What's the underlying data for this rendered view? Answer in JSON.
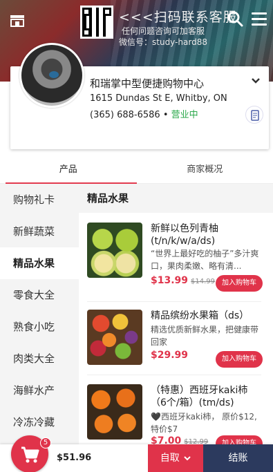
{
  "banner": {
    "line1": "<<<扫码联系客服",
    "line2": "任何问题咨询可加客服",
    "line3": "微信号：study-hard88"
  },
  "store": {
    "name": "和瑞掌中型便捷购物中心",
    "address": "1615 Dundas St E, Whitby, ON",
    "phone": "(365) 688-6586",
    "separator": "•",
    "status": "营业中"
  },
  "tabs": [
    {
      "label": "产品"
    },
    {
      "label": "商家概况"
    }
  ],
  "sidebar": {
    "items": [
      {
        "label": "购物礼卡"
      },
      {
        "label": "新鲜蔬菜"
      },
      {
        "label": "精品水果"
      },
      {
        "label": "零食大全"
      },
      {
        "label": "熟食小吃"
      },
      {
        "label": "肉类大全"
      },
      {
        "label": "海鲜水产"
      },
      {
        "label": "冷冻冷藏"
      }
    ],
    "active_index": 2
  },
  "section": {
    "title": "精品水果"
  },
  "products": [
    {
      "title": "新鲜以色列青柚(t/n/k/w/a/ds)",
      "description": "“世界上最好吃的柚子”多汁爽口，果肉柔嫩、略有清...",
      "price": "$13.99",
      "old_price": "$14.99",
      "button": "加入购物车"
    },
    {
      "title": "精品缤纷水果箱（ds）",
      "description": "精选优质新鲜水果，把健康带回家",
      "price": "$29.99",
      "old_price": "",
      "button": "加入购物车"
    },
    {
      "title": "（特惠）西班牙kaki柿（6个/箱）(tm/ds)",
      "description": "🖤西班牙kaki柿， 原价$12,特价$7",
      "price": "$7.00",
      "old_price": "$12.99",
      "button": "加入购物车"
    }
  ],
  "cart": {
    "count": "5",
    "total": "$51.96",
    "pickup_label": "自取",
    "checkout_label": "结账"
  },
  "colors": {
    "accent": "#e0334a",
    "open_status": "#2aa84a",
    "checkout_bg": "#2c3a5e"
  }
}
